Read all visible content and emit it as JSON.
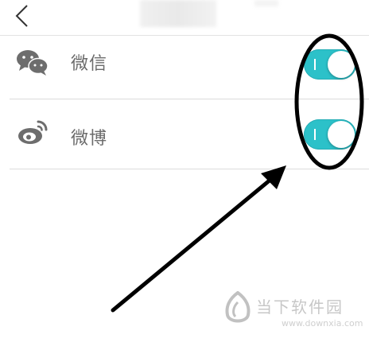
{
  "header": {
    "back_icon": "chevron-left-icon"
  },
  "settings": [
    {
      "label": "微信",
      "icon": "wechat-icon",
      "enabled": true
    },
    {
      "label": "微博",
      "icon": "weibo-icon",
      "enabled": true
    }
  ],
  "colors": {
    "toggle_on": "#2cc1c9",
    "label": "#6b6b6b",
    "divider": "#dcdcdc"
  },
  "watermark": {
    "text": "当下软件园",
    "url": "www.downxia.com"
  }
}
